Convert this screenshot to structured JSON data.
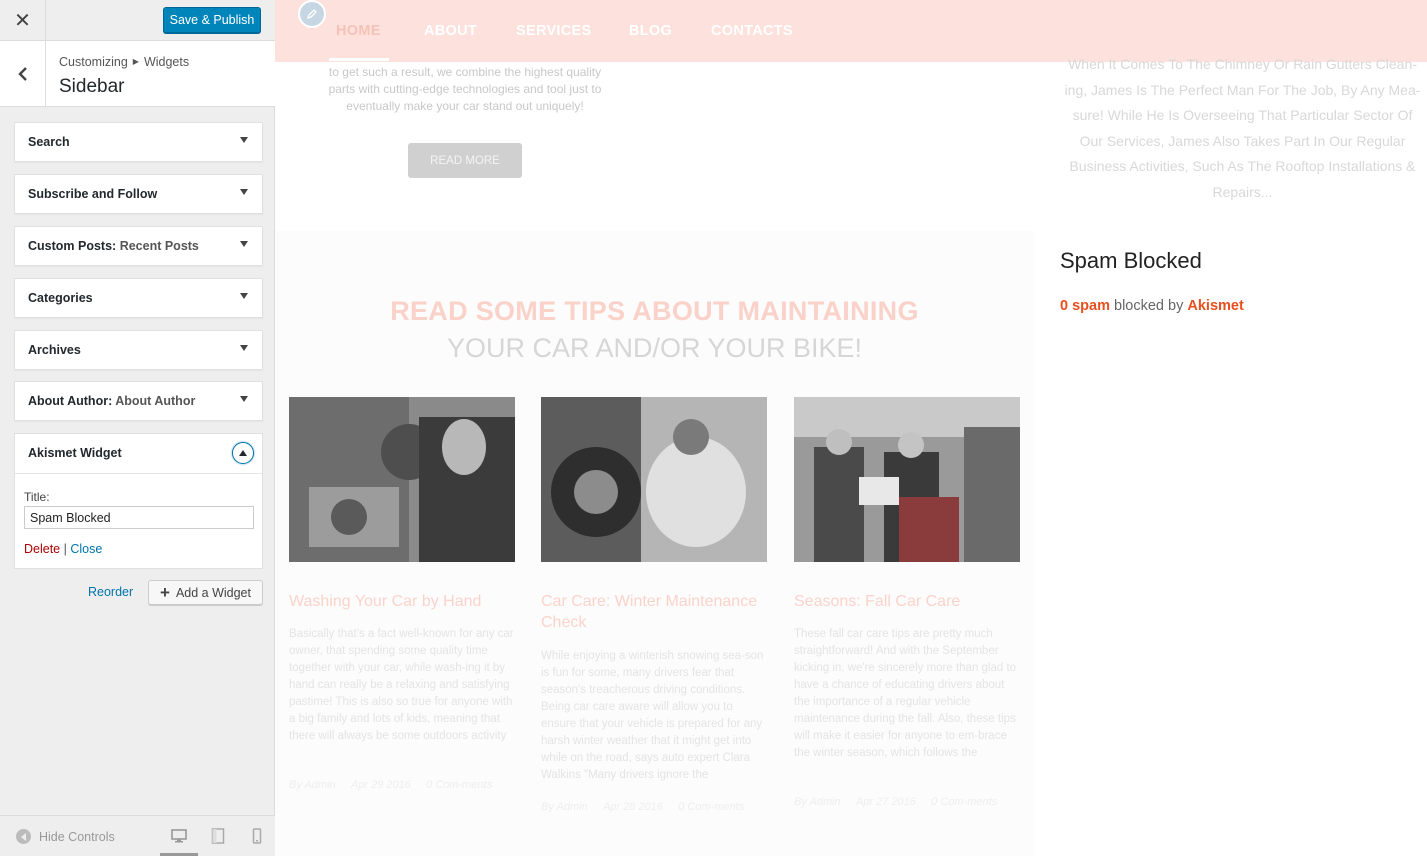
{
  "customizer": {
    "save_label": "Save & Publish",
    "breadcrumb": {
      "root": "Customizing",
      "child": "Widgets"
    },
    "section_title": "Sidebar",
    "widgets": [
      {
        "title": "Search",
        "subtitle": ""
      },
      {
        "title": "Subscribe and Follow",
        "subtitle": ""
      },
      {
        "title": "Custom Posts",
        "subtitle": "Recent Posts"
      },
      {
        "title": "Categories",
        "subtitle": ""
      },
      {
        "title": "Archives",
        "subtitle": ""
      },
      {
        "title": "About Author",
        "subtitle": "About Author"
      }
    ],
    "open_widget": {
      "title": "Akismet Widget",
      "field_label": "Title:",
      "field_value": "Spam Blocked",
      "delete_label": "Delete",
      "separator": "|",
      "close_label": "Close"
    },
    "reorder_label": "Reorder",
    "add_widget_label": "Add a Widget",
    "hide_controls_label": "Hide Controls"
  },
  "preview": {
    "nav": [
      "HOME",
      "ABOUT",
      "SERVICES",
      "BLOG",
      "CONTACTS"
    ],
    "top_text": "to get such a result, we combine the highest quality parts with cutting-edge technologies and tool just to eventually make your car stand out uniquely!",
    "read_more": "READ MORE",
    "right_text": "When It Comes To The Chimney Or Rain Gutters Clean-ing, James Is The Perfect Man For The Job, By Any Mea-sure! While He Is Overseeing That Particular Sector Of Our Services, James Also Takes Part In Our Regular Business Activities, Such As The Rooftop Installations & Repairs...",
    "tips_title_1": "READ SOME TIPS ABOUT MAINTAINING",
    "tips_title_2": "YOUR CAR AND/OR YOUR BIKE!",
    "posts": [
      {
        "title": "Washing Your Car by Hand",
        "excerpt": "Basically that's a fact well-known for any car owner, that spending some quality time together with your car, while wash-ing it by hand can really be a relaxing and satisfying pastime! This is also so true for anyone with a big family and lots of kids, meaning that there will always be some outdoors activity",
        "author": "By Admin",
        "date": "Apr 29 2016",
        "comments": "0 Com-ments"
      },
      {
        "title": "Car Care: Winter Maintenance Check",
        "excerpt": "While enjoying a winterish snowing sea-son is fun for some, many drivers fear that season's treacherous driving conditions. Being car care aware will allow you to ensure that your vehicle is prepared for any harsh winter weather that it might get into while on the road, says auto expert Clara Walkins \"Many drivers ignore the",
        "author": "By Admin",
        "date": "Apr 28 2016",
        "comments": "0 Com-ments"
      },
      {
        "title": "Seasons: Fall Car Care",
        "excerpt": "These fall car care tips are pretty much straightforward! And with the September kicking in, we're sincerely more than glad to have a chance of educating drivers about the importance of a regular vehicle maintenance during the fall. Also, these tips will make it easier for anyone to em-brace the winter season, which follows the",
        "author": "By Admin",
        "date": "Apr 27 2016",
        "comments": "0 Com-ments"
      }
    ],
    "spam_widget": {
      "title": "Spam Blocked",
      "count": "0 spam",
      "middle": "blocked by",
      "brand": "Akismet"
    }
  }
}
